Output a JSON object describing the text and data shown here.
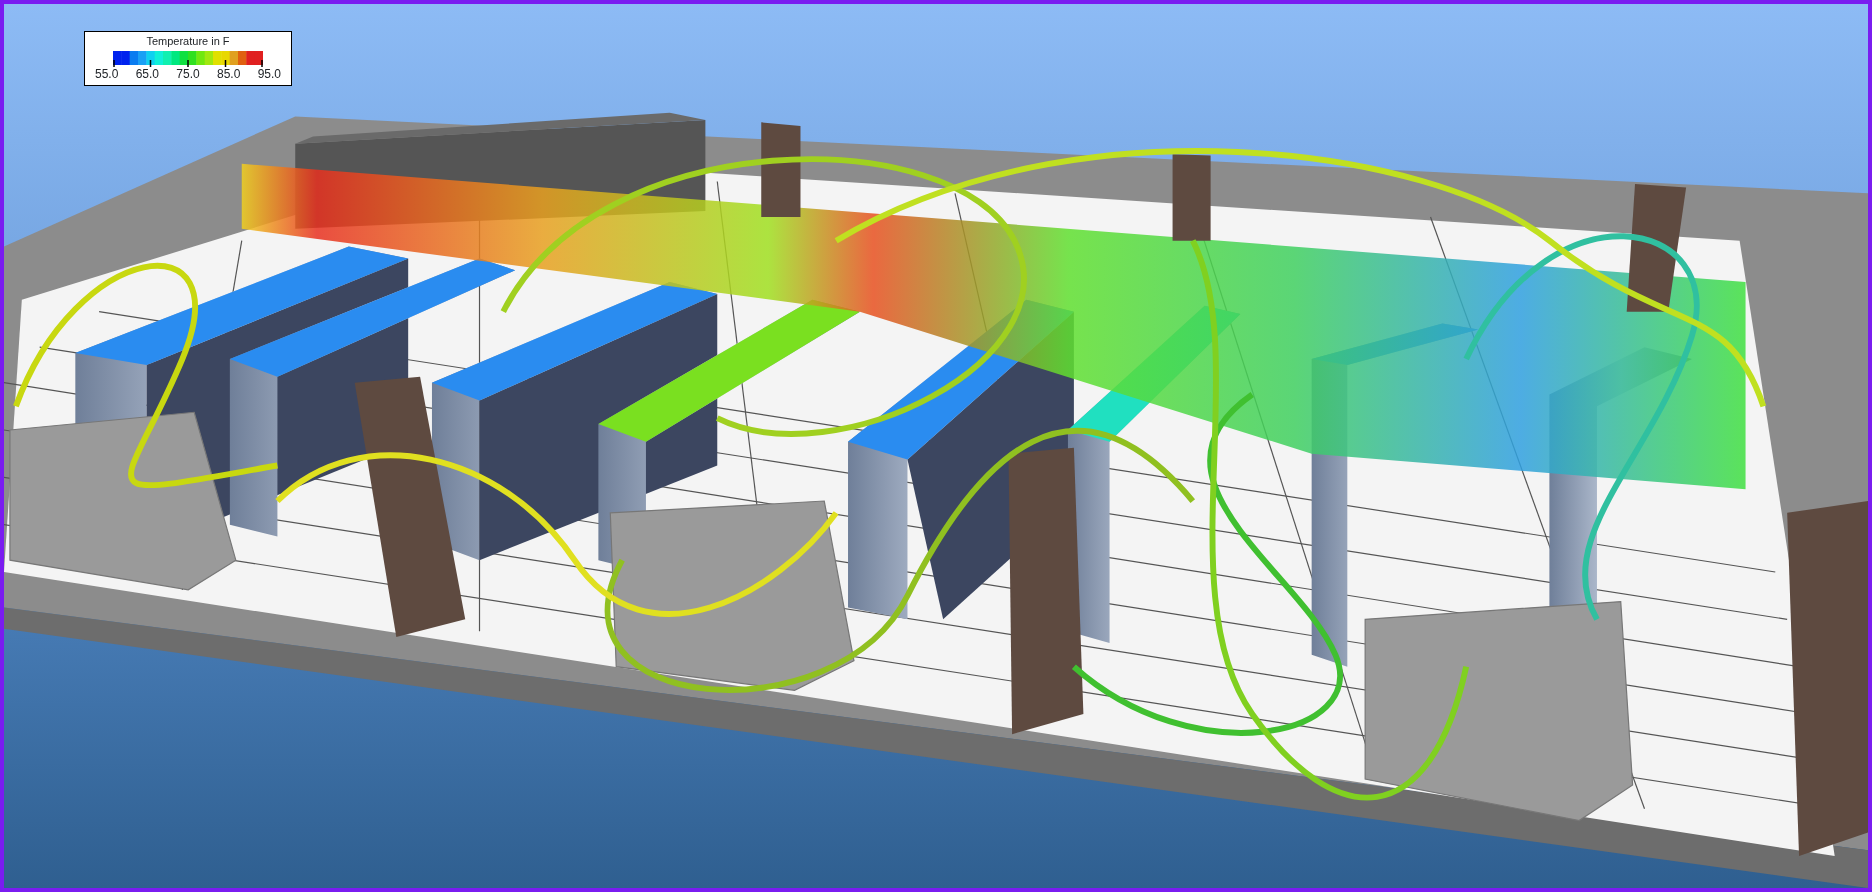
{
  "legend": {
    "title": "Temperature in F",
    "ticks": [
      "55.0",
      "65.0",
      "75.0",
      "85.0",
      "95.0"
    ]
  }
}
